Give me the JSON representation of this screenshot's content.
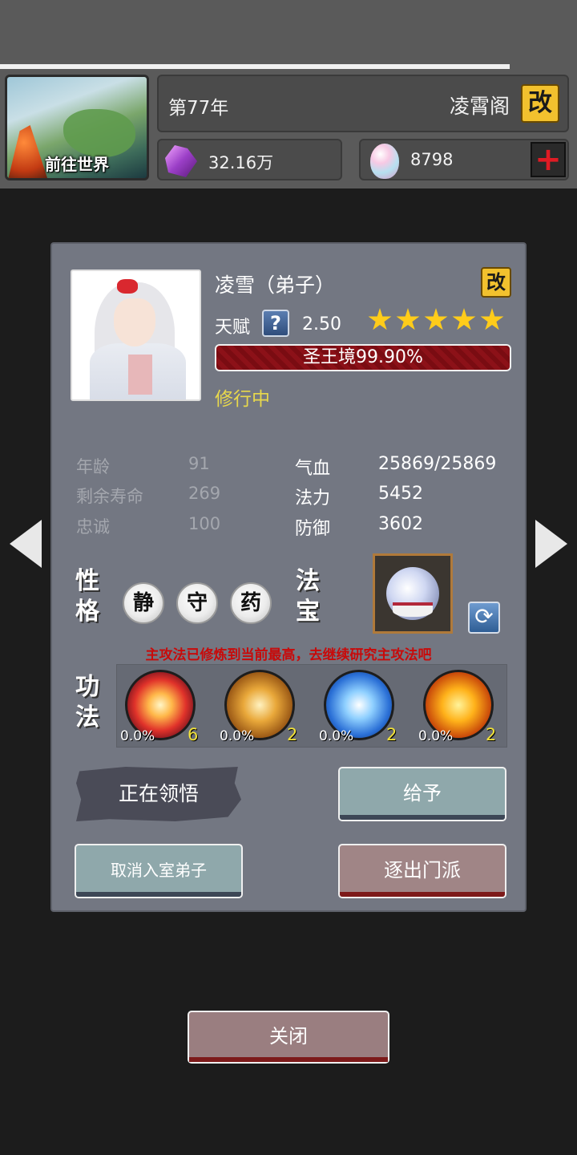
{
  "top": {
    "world_button_label": "前往世界",
    "year": "第77年",
    "sect_name": "凌霄阁",
    "rename_glyph": "改",
    "spirit_stones": "32.16万",
    "gems": "8798",
    "add_glyph": "+"
  },
  "panel": {
    "name": "凌雪（弟子）",
    "rename_glyph": "改",
    "talent_label": "天赋",
    "help_glyph": "?",
    "talent_value": "2.50",
    "star_count": 5,
    "realm": "圣王境99.90%",
    "status": "修行中",
    "stats_left": [
      {
        "label": "年龄",
        "value": "91"
      },
      {
        "label": "剩余寿命",
        "value": "269"
      },
      {
        "label": "忠诚",
        "value": "100"
      }
    ],
    "stats_right": [
      {
        "label": "气血",
        "value": "25869/25869"
      },
      {
        "label": "法力",
        "value": "5452"
      },
      {
        "label": "防御",
        "value": "3602"
      }
    ],
    "personality_label": [
      "性",
      "格"
    ],
    "traits": [
      "静",
      "守",
      "药"
    ],
    "treasure_label": [
      "法",
      "宝"
    ],
    "treasure_icon": "demon-mirror-icon",
    "refresh_glyph": "⟳",
    "warning": "主攻法已修炼到当前最高，去继续研究主攻法吧",
    "skills_label": [
      "功",
      "法"
    ],
    "skills": [
      {
        "icon": "fire-burst-icon",
        "progress": "0.0%",
        "level": "6"
      },
      {
        "icon": "golden-fist-icon",
        "progress": "0.0%",
        "level": "2"
      },
      {
        "icon": "ice-lightning-icon",
        "progress": "0.0%",
        "level": "2"
      },
      {
        "icon": "golden-flame-icon",
        "progress": "0.0%",
        "level": "2"
      }
    ],
    "comprehending_label": "正在领悟",
    "give_label": "给予",
    "cancel_inner_label": "取消入室弟子",
    "expel_label": "逐出门派"
  },
  "close_label": "关闭",
  "colors": {
    "panel_bg": "#737782",
    "realm_bar": "#7a0c12",
    "status_text": "#e8d84c",
    "warning_text": "#c80a0a",
    "star": "#ffcc1a",
    "level_text": "#f1e23a"
  }
}
